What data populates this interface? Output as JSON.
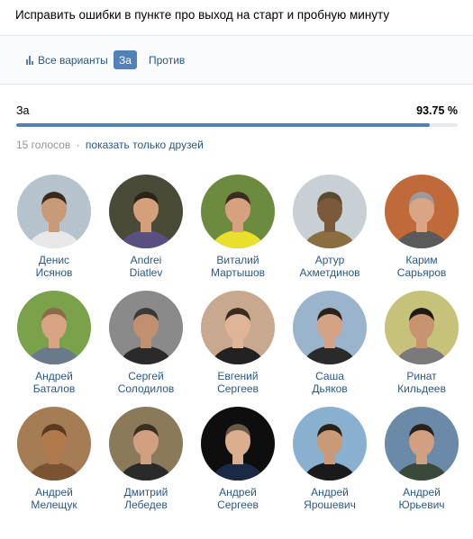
{
  "poll": {
    "title": "Исправить ошибки в пункте про выход на старт и пробную минуту"
  },
  "tabs": [
    {
      "label": "Все варианты",
      "active": false
    },
    {
      "label": "За",
      "active": true
    },
    {
      "label": "Против",
      "active": false
    }
  ],
  "result": {
    "option_label": "За",
    "percent_text": "93.75 %",
    "percent_value": 93.75
  },
  "votes": {
    "count_text": "15 голосов",
    "separator": "·",
    "friends_link": "показать только друзей"
  },
  "colors": {
    "accent": "#5181b8",
    "link": "#2a5885",
    "muted": "#939393"
  },
  "voters": [
    {
      "first": "Денис",
      "last": "Исянов",
      "avatar": {
        "bg": "#b7c3cc",
        "face": "#c89a78",
        "body": "#e8e8e8",
        "hair": "#3a2a1e"
      }
    },
    {
      "first": "Andrei",
      "last": "Diatlev",
      "avatar": {
        "bg": "#4a4a38",
        "face": "#d4a07a",
        "body": "#5a5080",
        "hair": "#2b2418"
      }
    },
    {
      "first": "Виталий",
      "last": "Мартышов",
      "avatar": {
        "bg": "#6d8b3f",
        "face": "#d7a07f",
        "body": "#e8e02a",
        "hair": "#3a2c20"
      }
    },
    {
      "first": "Артур",
      "last": "Ахметдинов",
      "avatar": {
        "bg": "#c8d0d6",
        "face": "#7a5a3a",
        "body": "#8a6d40",
        "hair": "#5a4a30"
      }
    },
    {
      "first": "Карим",
      "last": "Сарьяров",
      "avatar": {
        "bg": "#c06a3a",
        "face": "#d9a585",
        "body": "#5a5a5a",
        "hair": "#9a9a9a"
      }
    },
    {
      "first": "Андрей",
      "last": "Баталов",
      "avatar": {
        "bg": "#7aa24a",
        "face": "#d8a484",
        "body": "#6a7a8a",
        "hair": "#8a6a48"
      }
    },
    {
      "first": "Сергей",
      "last": "Солодилов",
      "avatar": {
        "bg": "#8a8a8a",
        "face": "#c09070",
        "body": "#2a2a2a",
        "hair": "#3a3a3a"
      }
    },
    {
      "first": "Евгений",
      "last": "Сергеев",
      "avatar": {
        "bg": "#c9a890",
        "face": "#e0b496",
        "body": "#222222",
        "hair": "#3a2a20"
      }
    },
    {
      "first": "Саша",
      "last": "Дьяков",
      "avatar": {
        "bg": "#9ab4cc",
        "face": "#d4a284",
        "body": "#2a2a2a",
        "hair": "#2a2218"
      }
    },
    {
      "first": "Ринат",
      "last": "Кильдеев",
      "avatar": {
        "bg": "#c7c27a",
        "face": "#c89470",
        "body": "#7a7a7a",
        "hair": "#1e1a14"
      }
    },
    {
      "first": "Андрей",
      "last": "Мелещук",
      "avatar": {
        "bg": "#a67c55",
        "face": "#b07a4c",
        "body": "#7a5432",
        "hair": "#5a3a20"
      }
    },
    {
      "first": "Дмитрий",
      "last": "Лебедев",
      "avatar": {
        "bg": "#8a7a5a",
        "face": "#d0a080",
        "body": "#2a2a2a",
        "hair": "#3a3020"
      }
    },
    {
      "first": "Андрей",
      "last": "Сергеев",
      "avatar": {
        "bg": "#0e0e0e",
        "face": "#dcae90",
        "body": "#1a2a44",
        "hair": "#6a5a48"
      }
    },
    {
      "first": "Андрей",
      "last": "Ярошевич",
      "avatar": {
        "bg": "#8ab0d0",
        "face": "#c99a78",
        "body": "#1a1a1a",
        "hair": "#2a2218"
      }
    },
    {
      "first": "Андрей",
      "last": "Юрьевич",
      "avatar": {
        "bg": "#6a8aa8",
        "face": "#d0a080",
        "body": "#3a4a3a",
        "hair": "#2a2218"
      }
    }
  ]
}
